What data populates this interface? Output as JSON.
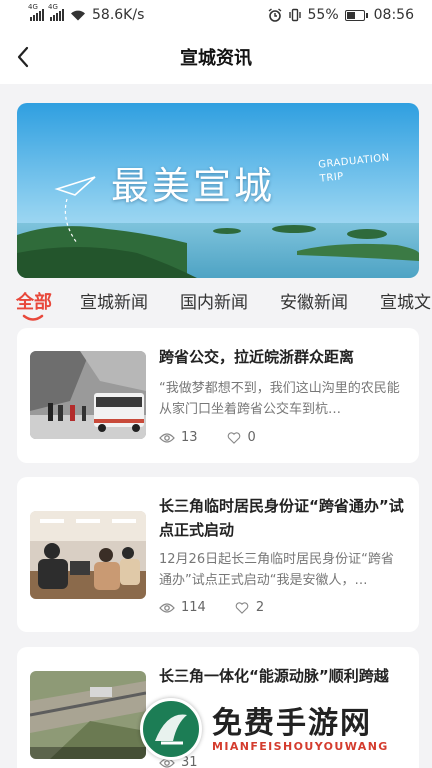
{
  "status_bar": {
    "network_speed": "58.6K/s",
    "battery_percent": "55%",
    "time": "08:56",
    "signal_tag": "4G"
  },
  "header": {
    "title": "宣城资讯"
  },
  "banner": {
    "title": "最美宣城",
    "subtitle_line1": "GRADUATION",
    "subtitle_line2": "TRIP"
  },
  "tabs": [
    {
      "label": "全部",
      "active": true
    },
    {
      "label": "宣城新闻"
    },
    {
      "label": "国内新闻"
    },
    {
      "label": "安徽新闻"
    },
    {
      "label": "宣城文"
    }
  ],
  "articles": [
    {
      "title": "跨省公交，拉近皖浙群众距离",
      "summary": "“我做梦都想不到，我们这山沟里的农民能从家门口坐着跨省公交车到杭…",
      "views": "13",
      "likes": "0"
    },
    {
      "title": "长三角临时居民身份证“跨省通办”试点正式启动",
      "summary": "12月26日起长三角临时居民身份证“跨省通办”试点正式启动“我是安徽人，…",
      "views": "114",
      "likes": "2"
    },
    {
      "title": "长三角一体化“能源动脉”顺利跨越",
      "summary": "",
      "views": "31",
      "likes": ""
    }
  ],
  "watermark": {
    "text": "免费手游网",
    "sub": "MIANFEISHOUYOUWANG"
  },
  "colors": {
    "accent": "#e8483b",
    "banner_sky": "#52b3e8"
  }
}
